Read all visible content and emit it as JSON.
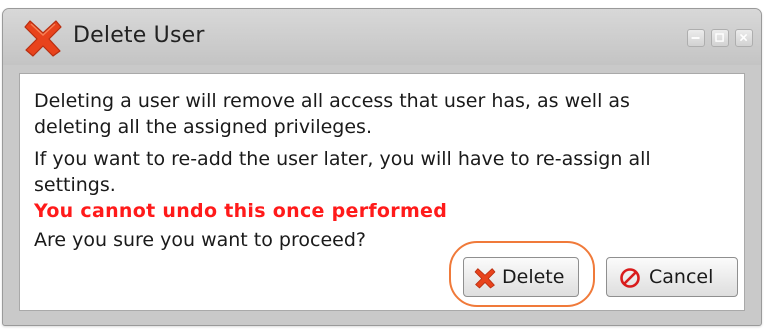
{
  "window": {
    "title": "Delete User",
    "title_icon": "red-x-icon",
    "controls": [
      "minimize-icon",
      "maximize-icon",
      "close-icon"
    ]
  },
  "message": {
    "line1": "Deleting a user will remove all access that user has, as well as",
    "line2": "deleting all the assigned privileges.",
    "line3": "If you want to re-add the user later, you will have to re-assign all",
    "line4": "settings.",
    "warning": "You cannot undo this once performed",
    "confirm": "Are you sure you want to proceed?"
  },
  "buttons": {
    "delete": {
      "label": "Delete",
      "icon": "red-x-icon",
      "highlighted": true
    },
    "cancel": {
      "label": "Cancel",
      "icon": "no-entry-icon"
    }
  },
  "colors": {
    "warning_text": "#ff1a1a",
    "highlight_ring": "#f07a3a",
    "delete_icon": "#e8431c",
    "cancel_icon": "#d91c1c"
  }
}
